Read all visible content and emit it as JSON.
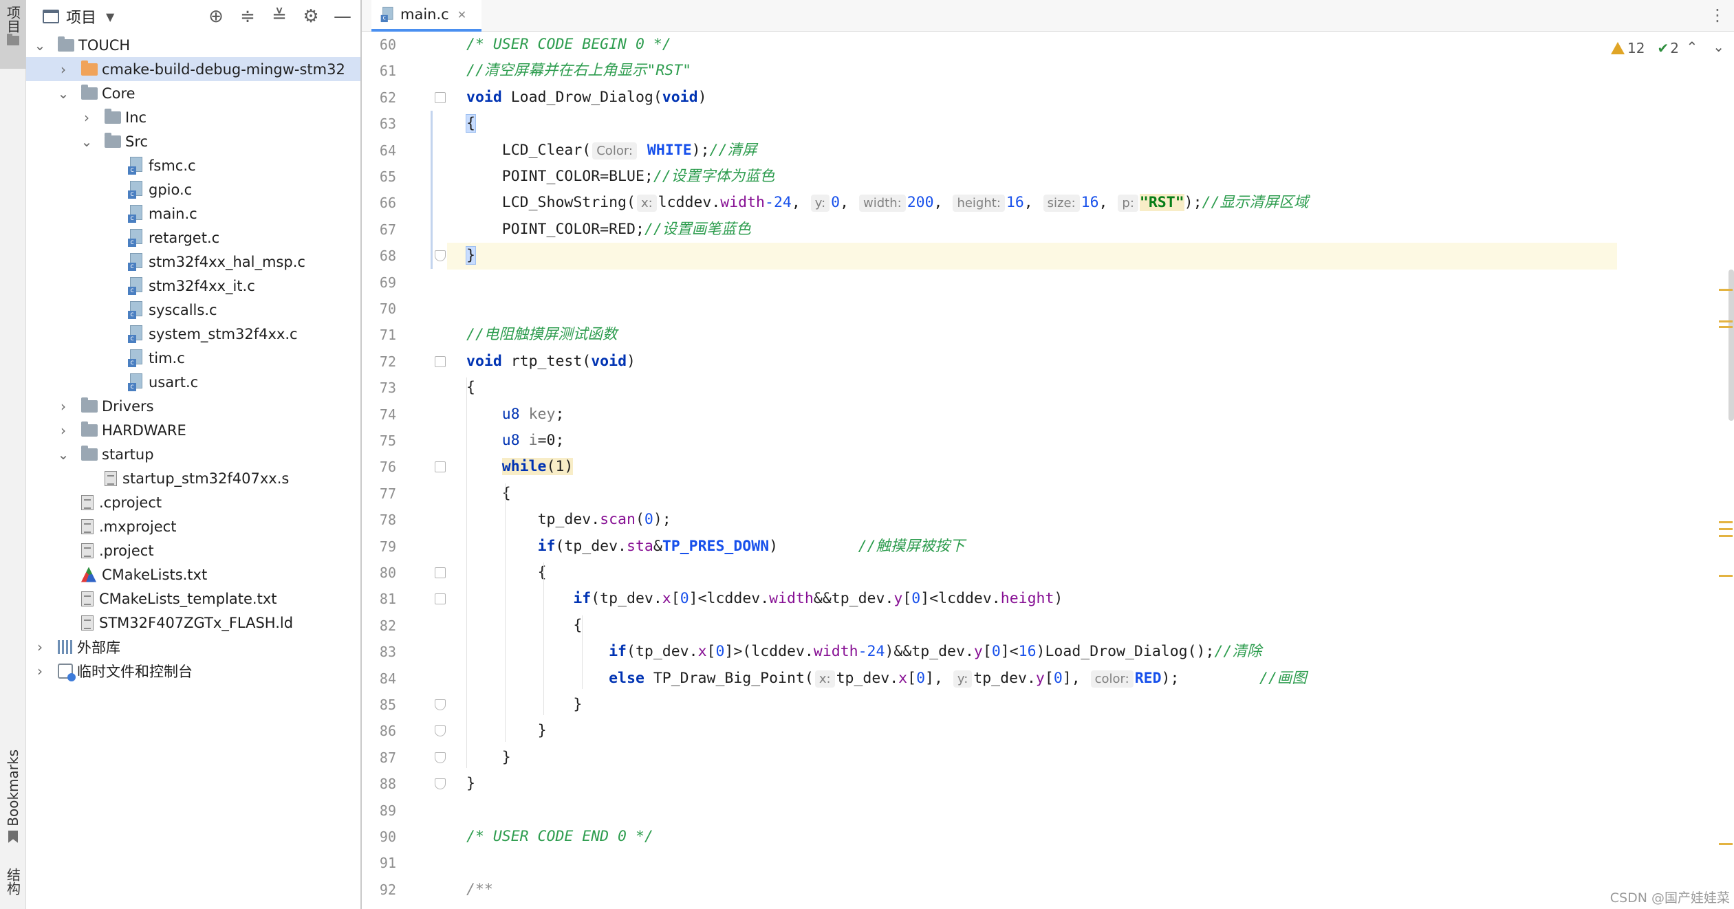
{
  "toolstrip": {
    "project_label": "项目",
    "bookmarks_label": "Bookmarks",
    "structure_label": "结构"
  },
  "project_panel": {
    "title": "项目",
    "tools": [
      "crosshair-icon",
      "expand-all-icon",
      "collapse-all-icon",
      "gear-icon",
      "minimize-icon"
    ]
  },
  "tree": [
    {
      "label": "TOUCH",
      "depth": 0,
      "arrow": "expanded",
      "icon": "folder"
    },
    {
      "label": "cmake-build-debug-mingw-stm32",
      "depth": 1,
      "arrow": "collapsed",
      "icon": "folder-orange",
      "selected": true
    },
    {
      "label": "Core",
      "depth": 1,
      "arrow": "expanded",
      "icon": "folder"
    },
    {
      "label": "Inc",
      "depth": 2,
      "arrow": "collapsed",
      "icon": "folder"
    },
    {
      "label": "Src",
      "depth": 2,
      "arrow": "expanded",
      "icon": "folder"
    },
    {
      "label": "fsmc.c",
      "depth": 3,
      "icon": "c-file"
    },
    {
      "label": "gpio.c",
      "depth": 3,
      "icon": "c-file"
    },
    {
      "label": "main.c",
      "depth": 3,
      "icon": "c-file"
    },
    {
      "label": "retarget.c",
      "depth": 3,
      "icon": "c-file"
    },
    {
      "label": "stm32f4xx_hal_msp.c",
      "depth": 3,
      "icon": "c-file"
    },
    {
      "label": "stm32f4xx_it.c",
      "depth": 3,
      "icon": "c-file"
    },
    {
      "label": "syscalls.c",
      "depth": 3,
      "icon": "c-file"
    },
    {
      "label": "system_stm32f4xx.c",
      "depth": 3,
      "icon": "c-file"
    },
    {
      "label": "tim.c",
      "depth": 3,
      "icon": "c-file"
    },
    {
      "label": "usart.c",
      "depth": 3,
      "icon": "c-file"
    },
    {
      "label": "Drivers",
      "depth": 1,
      "arrow": "collapsed",
      "icon": "folder"
    },
    {
      "label": "HARDWARE",
      "depth": 1,
      "arrow": "collapsed",
      "icon": "folder"
    },
    {
      "label": "startup",
      "depth": 1,
      "arrow": "expanded",
      "icon": "folder"
    },
    {
      "label": "startup_stm32f407xx.s",
      "depth": 2,
      "icon": "doc"
    },
    {
      "label": ".cproject",
      "depth": 1,
      "icon": "doc"
    },
    {
      "label": ".mxproject",
      "depth": 1,
      "icon": "doc"
    },
    {
      "label": ".project",
      "depth": 1,
      "icon": "doc"
    },
    {
      "label": "CMakeLists.txt",
      "depth": 1,
      "icon": "cmake"
    },
    {
      "label": "CMakeLists_template.txt",
      "depth": 1,
      "icon": "doc"
    },
    {
      "label": "STM32F407ZGTx_FLASH.ld",
      "depth": 1,
      "icon": "doc"
    },
    {
      "label": "外部库",
      "depth": 0,
      "arrow": "collapsed",
      "icon": "library"
    },
    {
      "label": "临时文件和控制台",
      "depth": 0,
      "arrow": "collapsed",
      "icon": "scratch"
    }
  ],
  "editor": {
    "tab_label": "main.c",
    "warnings_count": "12",
    "ok_count": "2",
    "line_numbers": [
      "60",
      "61",
      "62",
      "63",
      "64",
      "65",
      "66",
      "67",
      "68",
      "69",
      "70",
      "71",
      "72",
      "73",
      "74",
      "75",
      "76",
      "77",
      "78",
      "79",
      "80",
      "81",
      "82",
      "83",
      "84",
      "85",
      "86",
      "87",
      "88",
      "89",
      "90",
      "91",
      "92"
    ],
    "code": {
      "l60": "/* USER CODE BEGIN 0 */",
      "l61": "//清空屏幕并在右上角显示\"RST\"",
      "l62_kw": "void",
      "l62_name": " Load_Drow_Dialog(",
      "l62_kw2": "void",
      "l62_end": ")",
      "l63": "{",
      "l64_fn": "LCD_Clear(",
      "l64_hint": "Color:",
      "l64_arg": " WHITE",
      "l64_end": ");",
      "l64_cmt": "//清屏",
      "l65_code": "POINT_COLOR=BLUE;",
      "l65_cmt": "//设置字体为蓝色",
      "l66_fn": "LCD_ShowString(",
      "l66_h1": "x:",
      "l66_a1": "lcddev.",
      "l66_f1": "width",
      "l66_a1b": "-24",
      "l66_h2": "y:",
      "l66_a2": "0",
      "l66_h3": "width:",
      "l66_a3": "200",
      "l66_h4": "height:",
      "l66_a4": "16",
      "l66_h5": "size:",
      "l66_a5": "16",
      "l66_h6": "p:",
      "l66_str": "\"RST\"",
      "l66_end": ");",
      "l66_cmt": "//显示清屏区域",
      "l67_code": "POINT_COLOR=RED;",
      "l67_cmt": "//设置画笔蓝色",
      "l68": "}",
      "l71_cmt": "//电阻触摸屏测试函数",
      "l72_kw": "void",
      "l72_name": " rtp_test(",
      "l72_kw2": "void",
      "l72_end": ")",
      "l73": "{",
      "l74_type": "u8",
      "l74_var": " key",
      "l74_end": ";",
      "l75_type": "u8",
      "l75_var": " i",
      "l75_end": "=0;",
      "l76_kw": "while",
      "l76_arg": "(1)",
      "l77": "{",
      "l78_a": "tp_dev.",
      "l78_f": "scan",
      "l78_b": "(",
      "l78_n": "0",
      "l78_c": ");",
      "l79_kw": "if",
      "l79_a": "(tp_dev.",
      "l79_f": "sta",
      "l79_b": "&",
      "l79_c": "TP_PRES_DOWN",
      "l79_d": ")",
      "l79_cmt": "//触摸屏被按下",
      "l80": "{",
      "l81_kw": "if",
      "l81_a": "(tp_dev.",
      "l81_f1": "x",
      "l81_b": "[",
      "l81_n1": "0",
      "l81_c": "]<lcddev.",
      "l81_f2": "width",
      "l81_d": "&&tp_dev.",
      "l81_f3": "y",
      "l81_e": "[",
      "l81_n2": "0",
      "l81_g": "]<lcddev.",
      "l81_f4": "height",
      "l81_h": ")",
      "l82": "{",
      "l83_kw": "if",
      "l83_a": "(tp_dev.",
      "l83_f1": "x",
      "l83_b": "[",
      "l83_n1": "0",
      "l83_c": "]>(lcddev.",
      "l83_f2": "width",
      "l83_n2": "-24",
      "l83_d": ")&&tp_dev.",
      "l83_f3": "y",
      "l83_e": "[",
      "l83_n3": "0",
      "l83_g": "]<",
      "l83_n4": "16",
      "l83_h": ")Load_Drow_Dialog();",
      "l83_cmt": "//清除",
      "l84_kw": "else",
      "l84_fn": " TP_Draw_Big_Point(",
      "l84_h1": "x:",
      "l84_a1": "tp_dev.",
      "l84_f1": "x",
      "l84_b1": "[",
      "l84_n1": "0",
      "l84_c1": "],",
      "l84_h2": "y:",
      "l84_a2": "tp_dev.",
      "l84_f2": "y",
      "l84_b2": "[",
      "l84_n2": "0",
      "l84_c2": "],",
      "l84_h3": "color:",
      "l84_a3": "RED",
      "l84_end": ");",
      "l84_cmt": "//画图",
      "l85": "}",
      "l86": "}",
      "l87": "}",
      "l88": "}",
      "l90": "/* USER CODE END 0 */",
      "l92": "/**"
    }
  },
  "watermark": "CSDN @国产娃娃菜",
  "colors": {
    "keyword": "#0033b3",
    "comment_green": "#2e9d4f",
    "comment_grey": "#8c8c8c",
    "string": "#067d17",
    "number": "#1750eb",
    "field": "#871094",
    "selection": "#d5e1f5",
    "current_line": "#fdf9e3",
    "tab_accent": "#4a8ff0"
  }
}
